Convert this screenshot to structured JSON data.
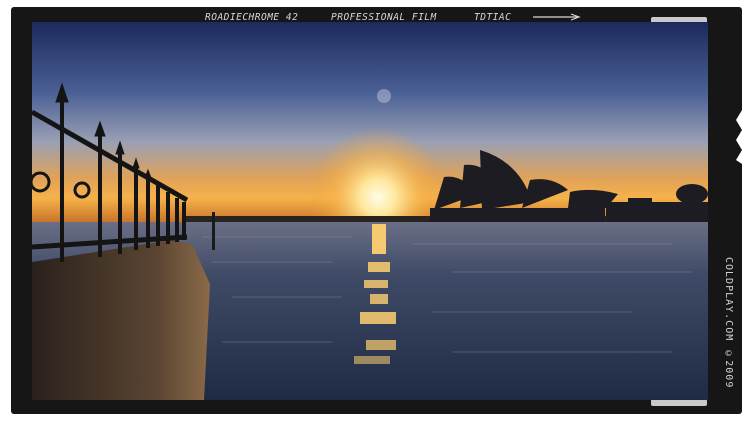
{
  "film_header": {
    "brand": "ROADIECHROME 42",
    "film_type": "PROFESSIONAL FILM",
    "code": "TDTIAC"
  },
  "side_caption": "COLDPLAY.COM ©2009",
  "scene": {
    "subject": "sydney-opera-house-sunset",
    "colors": {
      "sky_top": "#1e2b5a",
      "sky_mid": "#5a6b9a",
      "horizon": "#f0a23a",
      "sun": "#fff4c8",
      "water": "#3b4a6a",
      "silhouette": "#1a1a1f"
    }
  }
}
